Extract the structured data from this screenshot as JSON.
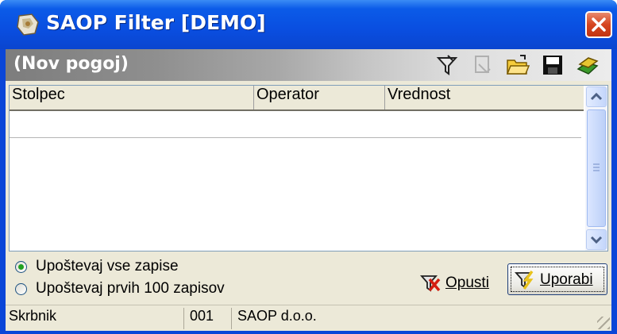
{
  "window": {
    "title": "SAOP Filter [DEMO]",
    "titlebar_color": "#0a4ee0",
    "close_color": "#d6451f"
  },
  "condition_bar": {
    "label": "(Nov pogoj)",
    "toolbar_icons": [
      "filter-add-icon",
      "filter-edit-icon",
      "open-folder-icon",
      "save-disk-icon",
      "books-icon"
    ]
  },
  "grid": {
    "columns": [
      "Stolpec",
      "Operator",
      "Vrednost"
    ]
  },
  "options": {
    "all_records": "Upoštevaj vse zapise",
    "first_100": "Upoštevaj prvih 100 zapisov",
    "selected": "all_records"
  },
  "buttons": {
    "cancel": "Opusti",
    "apply": "Uporabi"
  },
  "status": {
    "user": "Skrbnik",
    "code": "001",
    "company": "SAOP d.o.o."
  }
}
